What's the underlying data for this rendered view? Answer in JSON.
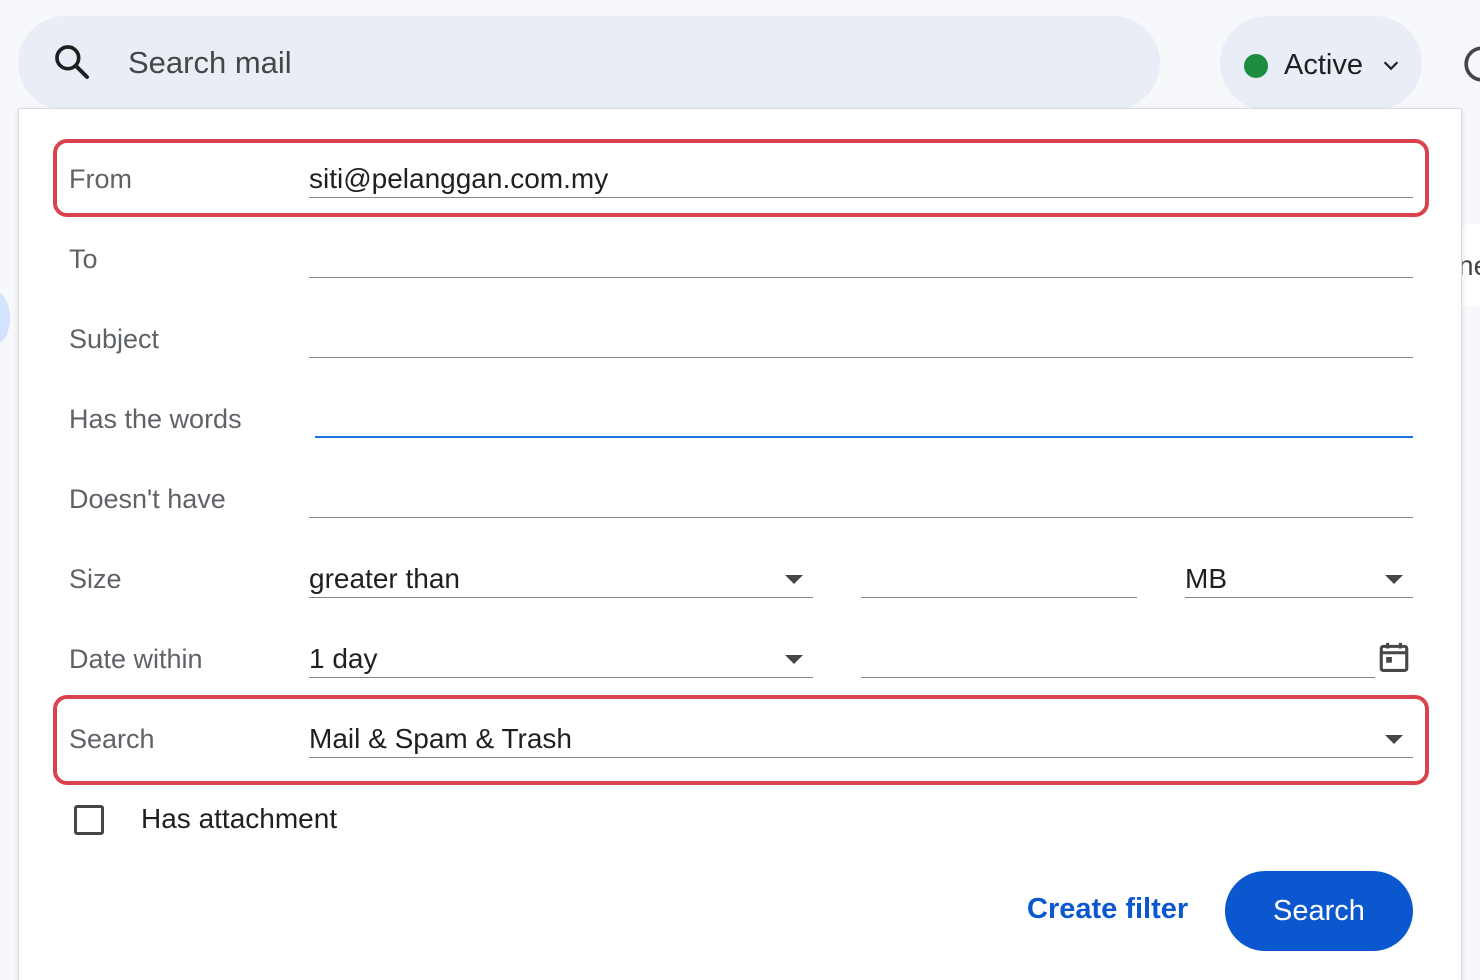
{
  "search": {
    "placeholder": "Search mail",
    "icon": "search-icon"
  },
  "status": {
    "label": "Active",
    "dot_color": "#1e8e3e"
  },
  "background": {
    "right_edge_text": "ne"
  },
  "form": {
    "from": {
      "label": "From",
      "value": "siti@pelanggan.com.my"
    },
    "to": {
      "label": "To",
      "value": ""
    },
    "subject": {
      "label": "Subject",
      "value": ""
    },
    "has_words": {
      "label": "Has the words",
      "value": ""
    },
    "doesnt_have": {
      "label": "Doesn't have",
      "value": ""
    },
    "size": {
      "label": "Size",
      "operator": "greater than",
      "value": "",
      "unit": "MB"
    },
    "date_within": {
      "label": "Date within",
      "value": "1 day",
      "date": ""
    },
    "search_in": {
      "label": "Search",
      "value": "Mail & Spam & Trash"
    },
    "has_attachment": {
      "label": "Has attachment",
      "checked": false
    }
  },
  "actions": {
    "create_filter": "Create filter",
    "search": "Search"
  },
  "colors": {
    "accent": "#0b57d0",
    "highlight": "#d9434e",
    "active_underline": "#1a73e8"
  }
}
